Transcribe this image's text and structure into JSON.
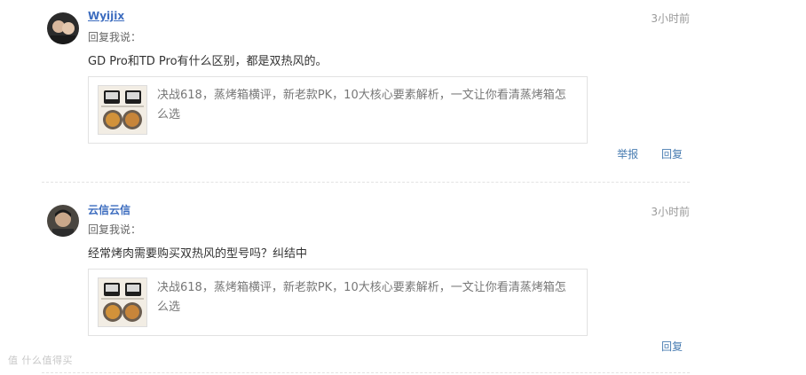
{
  "comments": [
    {
      "username": "Wyijix",
      "time": "3小时前",
      "reply_label": "回复我说：",
      "text": "GD Pro和TD Pro有什么区别，都是双热风的。",
      "article": {
        "title": "决战618，蒸烤箱横评，新老款PK，10大核心要素解析，一文让你看清蒸烤箱怎么选",
        "thumbnail_icon": "steam-oven-thumbnail"
      },
      "actions": {
        "report": "举报",
        "reply": "回复"
      }
    },
    {
      "username": "云信云信",
      "time": "3小时前",
      "reply_label": "回复我说：",
      "text": "经常烤肉需要购买双热风的型号吗？纠结中",
      "article": {
        "title": "决战618，蒸烤箱横评，新老款PK，10大核心要素解析，一文让你看清蒸烤箱怎么选",
        "thumbnail_icon": "steam-oven-thumbnail"
      },
      "actions": {
        "reply": "回复"
      }
    }
  ],
  "watermark": "值 什么值得买"
}
